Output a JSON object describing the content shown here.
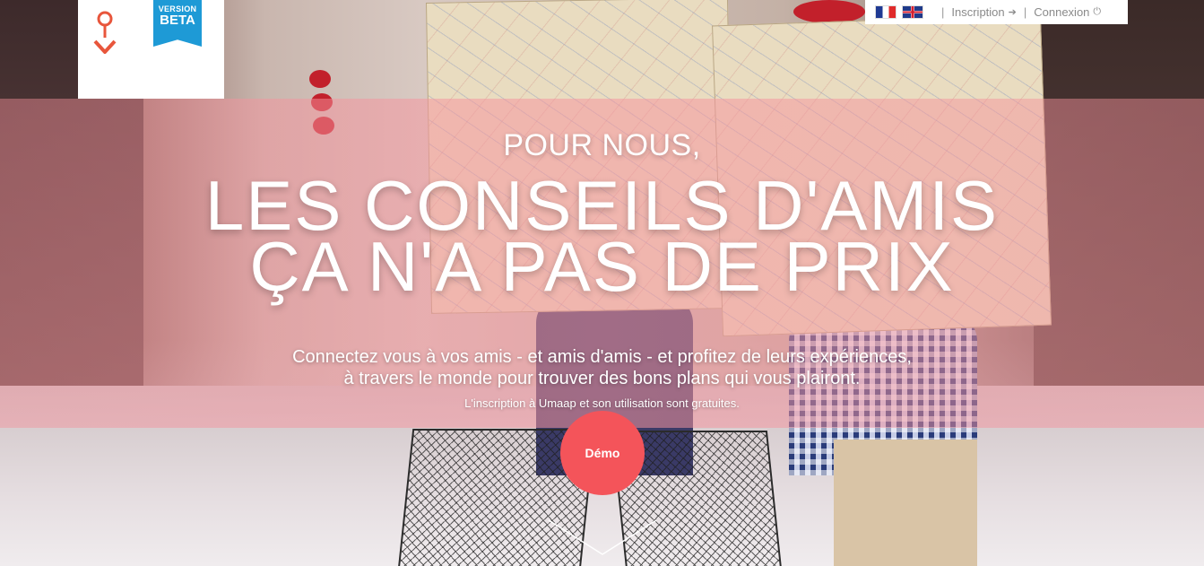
{
  "brand": {
    "badge_line1": "VERSION",
    "badge_line2": "BETA",
    "pin_color": "#e8563c",
    "badge_color": "#1e9ad6"
  },
  "topnav": {
    "languages": [
      "french-flag-icon",
      "uk-flag-icon"
    ],
    "signup_label": "Inscription",
    "login_label": "Connexion"
  },
  "hero": {
    "kicker": "POUR NOUS,",
    "title_line1": "LES CONSEILS D'AMIS",
    "title_line2": "ÇA N'A PAS DE PRIX",
    "subtitle_line1": "Connectez vous à vos amis - et amis d'amis - et profitez de leurs expériences,",
    "subtitle_line2": "à travers le monde pour trouver des bons plans qui vous plairont.",
    "note": "L'inscription à Umaap et son utilisation sont gratuites.",
    "demo_label": "Démo",
    "accent_color": "#f4545a"
  }
}
